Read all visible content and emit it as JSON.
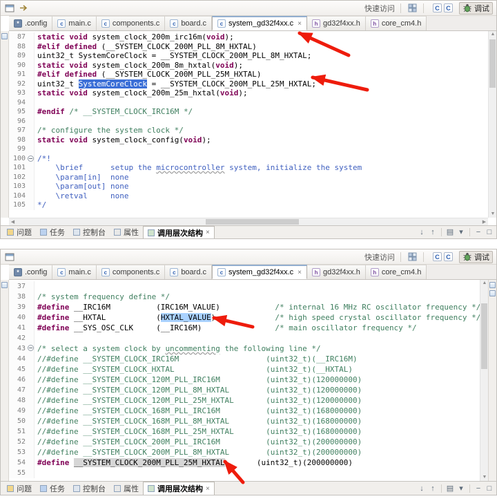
{
  "colors": {
    "keyword": "#7f0055",
    "comment": "#3f7f5f",
    "doc_comment": "#3f5fbf",
    "selection_bg": "#3b6fd7",
    "word_highlight_bg": "#aad2ff",
    "occurrence_bg": "#d6d6d6",
    "annotation_arrow": "#ee1c0c"
  },
  "window": {
    "quick_access": "快速访问",
    "perspective_c_label": "C",
    "perspective_debug_label": "调试"
  },
  "tabs": [
    {
      "label": ".config",
      "kind": "config"
    },
    {
      "label": "main.c",
      "kind": "c"
    },
    {
      "label": "components.c",
      "kind": "c"
    },
    {
      "label": "board.c",
      "kind": "c"
    },
    {
      "label": "system_gd32f4xx.c",
      "kind": "c",
      "active": true,
      "close": "×"
    },
    {
      "label": "gd32f4xx.h",
      "kind": "h"
    },
    {
      "label": "core_cm4.h",
      "kind": "h"
    }
  ],
  "views": [
    {
      "label": "问题",
      "icon": "problems-icon"
    },
    {
      "label": "任务",
      "icon": "tasks-icon"
    },
    {
      "label": "控制台",
      "icon": "console-icon"
    },
    {
      "label": "属性",
      "icon": "properties-icon"
    },
    {
      "label": "调用层次结构",
      "icon": "call-hierarchy-icon",
      "active": true,
      "close": "×"
    }
  ],
  "view_toolbar_icons": [
    {
      "name": "next-element-icon",
      "glyph": "↓"
    },
    {
      "name": "previous-element-icon",
      "glyph": "↑"
    },
    {
      "name": "sep"
    },
    {
      "name": "layout-icon",
      "glyph": "▤"
    },
    {
      "name": "view-menu-icon",
      "glyph": "▾"
    },
    {
      "name": "sep"
    },
    {
      "name": "minimize-icon",
      "glyph": "−"
    },
    {
      "name": "maximize-icon",
      "glyph": "□"
    }
  ],
  "scroll": {
    "h_left_arrow": "◀",
    "h_right_arrow": "▶",
    "v_up_arrow": "▲",
    "v_down_arrow": "▼"
  },
  "editor_top": {
    "lines": [
      {
        "n": 87,
        "seg": [
          [
            "static void",
            "k"
          ],
          [
            " system_clock_200m_irc16m(",
            "p"
          ],
          [
            "void",
            "k"
          ],
          [
            ");",
            "p"
          ]
        ]
      },
      {
        "n": 88,
        "seg": [
          [
            "#elif defined",
            "k"
          ],
          [
            " (__SYSTEM_CLOCK_200M_PLL_8M_HXTAL)",
            "p"
          ]
        ]
      },
      {
        "n": 89,
        "seg": [
          [
            "uint32_t SystemCoreClock = __SYSTEM_CLOCK_200M_PLL_8M_HXTAL;",
            "p"
          ]
        ]
      },
      {
        "n": 90,
        "seg": [
          [
            "static void",
            "k"
          ],
          [
            " system_clock_200m_8m_hxtal(",
            "p"
          ],
          [
            "void",
            "k"
          ],
          [
            ");",
            "p"
          ]
        ]
      },
      {
        "n": 91,
        "seg": [
          [
            "#elif defined",
            "k"
          ],
          [
            " (__SYSTEM_CLOCK_200M_PLL_25M_HXTAL)",
            "p"
          ]
        ]
      },
      {
        "n": 92,
        "seg": [
          [
            "uint32_t ",
            "p"
          ],
          [
            "SystemCoreClock",
            "sel"
          ],
          [
            " = __SYSTEM_CLOCK_200M_PLL_25M_HXTAL;",
            "p"
          ]
        ]
      },
      {
        "n": 93,
        "seg": [
          [
            "static void",
            "k"
          ],
          [
            " system_clock_200m_25m_hxtal(",
            "p"
          ],
          [
            "void",
            "k"
          ],
          [
            ");",
            "p"
          ]
        ]
      },
      {
        "n": 94,
        "seg": []
      },
      {
        "n": 95,
        "seg": [
          [
            "#endif",
            "k"
          ],
          [
            " ",
            "p"
          ],
          [
            "/* __SYSTEM_CLOCK_IRC16M */",
            "c"
          ]
        ]
      },
      {
        "n": 96,
        "seg": []
      },
      {
        "n": 97,
        "seg": [
          [
            "/* configure the system clock */",
            "c"
          ]
        ]
      },
      {
        "n": 98,
        "seg": [
          [
            "static void",
            "k"
          ],
          [
            " system_clock_config(",
            "p"
          ],
          [
            "void",
            "k"
          ],
          [
            ");",
            "p"
          ]
        ]
      },
      {
        "n": 99,
        "seg": []
      },
      {
        "n": 100,
        "fold": true,
        "seg": [
          [
            "/*!",
            "d"
          ]
        ]
      },
      {
        "n": 101,
        "seg": [
          [
            "    \\brief      setup the ",
            "d"
          ],
          [
            "microcontroller",
            "d u"
          ],
          [
            " system, initialize the system",
            "d"
          ]
        ]
      },
      {
        "n": 102,
        "seg": [
          [
            "    \\param[in]  none",
            "d"
          ]
        ]
      },
      {
        "n": 103,
        "seg": [
          [
            "    \\param[out] none",
            "d"
          ]
        ]
      },
      {
        "n": 104,
        "seg": [
          [
            "    \\retval     none",
            "d"
          ]
        ]
      },
      {
        "n": 105,
        "seg": [
          [
            "*/",
            "d"
          ]
        ]
      }
    ]
  },
  "editor_bottom": {
    "lines": [
      {
        "n": 37,
        "seg": []
      },
      {
        "n": 38,
        "seg": [
          [
            "/* system frequency define */",
            "c"
          ]
        ]
      },
      {
        "n": 39,
        "seg": [
          [
            "#define",
            "k"
          ],
          [
            " __IRC16M          (IRC16M_VALUE)            ",
            "p"
          ],
          [
            "/* internal 16 MHz RC oscillator frequency */",
            "c"
          ]
        ]
      },
      {
        "n": 40,
        "seg": [
          [
            "#define",
            "k"
          ],
          [
            " __HXTAL           (",
            "p"
          ],
          [
            "HXTAL_VALUE",
            "hl"
          ],
          [
            ")             ",
            "p"
          ],
          [
            "/* high speed crystal oscillator frequency */",
            "c"
          ]
        ]
      },
      {
        "n": 41,
        "seg": [
          [
            "#define",
            "k"
          ],
          [
            " __SYS_OSC_CLK     (__IRC16M)                ",
            "p"
          ],
          [
            "/* main oscillator frequency */",
            "c"
          ]
        ]
      },
      {
        "n": 42,
        "seg": []
      },
      {
        "n": 43,
        "fold": true,
        "seg": [
          [
            "/* select a system clock by ",
            "c"
          ],
          [
            "uncommenting",
            "c u"
          ],
          [
            " the following line */",
            "c"
          ]
        ]
      },
      {
        "n": 44,
        "seg": [
          [
            "//#define __SYSTEM_CLOCK_IRC16M                   (uint32_t)(__IRC16M)",
            "c"
          ]
        ]
      },
      {
        "n": 45,
        "seg": [
          [
            "//#define __SYSTEM_CLOCK_HXTAL                    (uint32_t)(__HXTAL)",
            "c"
          ]
        ]
      },
      {
        "n": 46,
        "seg": [
          [
            "//#define __SYSTEM_CLOCK_120M_PLL_IRC16M          (uint32_t)(120000000)",
            "c"
          ]
        ]
      },
      {
        "n": 47,
        "seg": [
          [
            "//#define __SYSTEM_CLOCK_120M_PLL_8M_HXTAL        (uint32_t)(120000000)",
            "c"
          ]
        ]
      },
      {
        "n": 48,
        "seg": [
          [
            "//#define __SYSTEM_CLOCK_120M_PLL_25M_HXTAL       (uint32_t)(120000000)",
            "c"
          ]
        ]
      },
      {
        "n": 49,
        "seg": [
          [
            "//#define __SYSTEM_CLOCK_168M_PLL_IRC16M          (uint32_t)(168000000)",
            "c"
          ]
        ]
      },
      {
        "n": 50,
        "seg": [
          [
            "//#define __SYSTEM_CLOCK_168M_PLL_8M_HXTAL        (uint32_t)(168000000)",
            "c"
          ]
        ]
      },
      {
        "n": 51,
        "seg": [
          [
            "//#define __SYSTEM_CLOCK_168M_PLL_25M_HXTAL       (uint32_t)(168000000)",
            "c"
          ]
        ]
      },
      {
        "n": 52,
        "seg": [
          [
            "//#define __SYSTEM_CLOCK_200M_PLL_IRC16M          (uint32_t)(200000000)",
            "c"
          ]
        ]
      },
      {
        "n": 53,
        "seg": [
          [
            "//#define __SYSTEM_CLOCK_200M_PLL_8M_HXTAL        (uint32_t)(200000000)",
            "c"
          ]
        ]
      },
      {
        "n": 54,
        "seg": [
          [
            "#define",
            "k"
          ],
          [
            " ",
            "p"
          ],
          [
            "__SYSTEM_CLOCK_200M_PLL_25M_HXTAL",
            "occ"
          ],
          [
            "       (uint32_t)(200000000)",
            "p"
          ]
        ]
      },
      {
        "n": 55,
        "seg": []
      }
    ]
  }
}
